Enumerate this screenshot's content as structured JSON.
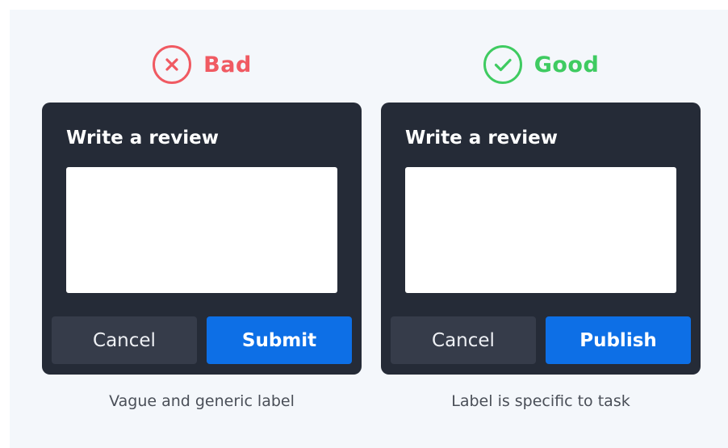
{
  "colors": {
    "background": "#f4f7fb",
    "card": "#252b37",
    "bad": "#f05a62",
    "good": "#3fcb61",
    "primary_button": "#0d6fe6",
    "cancel_button": "#363c4a"
  },
  "bad": {
    "icon": "x-circle-icon",
    "label": "Bad",
    "card_title": "Write a review",
    "cancel_label": "Cancel",
    "primary_label": "Submit",
    "caption": "Vague and generic label"
  },
  "good": {
    "icon": "check-circle-icon",
    "label": "Good",
    "card_title": "Write a review",
    "cancel_label": "Cancel",
    "primary_label": "Publish",
    "caption": "Label is specific to task"
  }
}
